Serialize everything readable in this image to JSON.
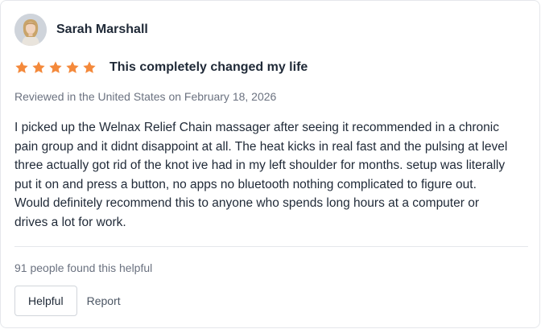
{
  "review": {
    "reviewer_name": "Sarah Marshall",
    "rating": 5,
    "rating_max": 5,
    "star_color": "#f4893b",
    "title": "This completely changed my life",
    "meta": "Reviewed in the United States on February 18, 2026",
    "body": "I picked up the Welnax Relief Chain massager after seeing it recommended in a chronic pain group and it didnt disappoint at all. The heat kicks in real fast and the pulsing at level three actually got rid of the knot ive had in my left shoulder for months. setup was literally put it on and press a button, no apps no bluetooth nothing complicated to figure out. Would definitely recommend this to anyone who spends long hours at a computer or drives a lot for work.",
    "helpful_count_text": "91 people found this helpful"
  },
  "actions": {
    "helpful_label": "Helpful",
    "report_label": "Report"
  }
}
